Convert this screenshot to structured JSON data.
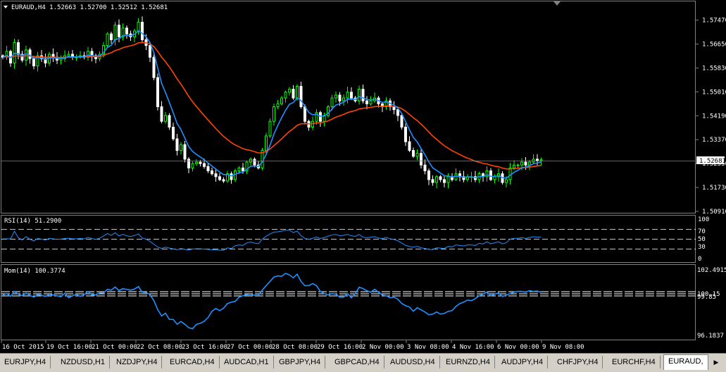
{
  "main_panel": {
    "header": "EURAUD,H4  1.52663 1.52700 1.52512 1.52681",
    "price_ticks": [
      "1.57470",
      "1.56650",
      "1.55830",
      "1.55010",
      "1.54190",
      "1.53370",
      "1.52550",
      "1.51730",
      "1.50910"
    ],
    "current_price": "1.52681"
  },
  "rsi_panel": {
    "header": "RSI(14) 51.2900",
    "ticks": [
      "100",
      "70",
      "50",
      "30",
      "0"
    ]
  },
  "mom_panel": {
    "header": "Mom(14) 100.3774",
    "ticks": [
      "102.4915",
      "100.15",
      "99.85",
      "96.1837"
    ]
  },
  "time_labels": [
    "16 Oct 2015",
    "19 Oct 16:00",
    "21 Oct 00:00",
    "22 Oct 08:00",
    "23 Oct 16:00",
    "27 Oct 00:00",
    "28 Oct 08:00",
    "29 Oct 16:00",
    "2 Nov 00:00",
    "3 Nov 08:00",
    "4 Nov 16:00",
    "6 Nov 00:00",
    "9 Nov 08:00"
  ],
  "tabs": [
    "EURJPY,H4",
    "NZDUSD,H1",
    "NZDJPY,H4",
    "EURCAD,H4",
    "AUDCAD,H1",
    "GBPJPY,H4",
    "GBPCAD,H4",
    "AUDUSD,H4",
    "EURNZD,H4",
    "AUDJPY,H4",
    "CHFJPY,H4",
    "EURCHF,H4",
    "EURAUD,"
  ],
  "active_tab": "EURAUD,",
  "colors": {
    "bull": "#00ff00",
    "bear": "#ffffff",
    "ma_fast": "#1e90ff",
    "ma_slow": "#ff4500",
    "indicator": "#1e90ff",
    "level": "#ffffff"
  },
  "chart_data": [
    {
      "type": "candlestick",
      "title": "EURAUD,H4",
      "ylim": [
        1.5091,
        1.5809
      ],
      "ohlc_header": {
        "open": 1.52663,
        "high": 1.527,
        "low": 1.52512,
        "close": 1.52681
      },
      "close": [
        1.562,
        1.564,
        1.56,
        1.567,
        1.563,
        1.561,
        1.5645,
        1.5615,
        1.559,
        1.5625,
        1.5615,
        1.56,
        1.563,
        1.562,
        1.561,
        1.5615,
        1.5625,
        1.563,
        1.562,
        1.562,
        1.5625,
        1.562,
        1.564,
        1.5625,
        1.5615,
        1.563,
        1.566,
        1.57,
        1.568,
        1.573,
        1.569,
        1.572,
        1.57,
        1.569,
        1.571,
        1.574,
        1.568,
        1.566,
        1.562,
        1.555,
        1.545,
        1.54,
        1.542,
        1.538,
        1.534,
        1.53,
        1.532,
        1.527,
        1.524,
        1.5255,
        1.526,
        1.5255,
        1.5245,
        1.523,
        1.522,
        1.521,
        1.52,
        1.5195,
        1.522,
        1.52,
        1.523,
        1.524,
        1.523,
        1.526,
        1.527,
        1.525,
        1.524,
        1.53,
        1.535,
        1.54,
        1.545,
        1.546,
        1.548,
        1.55,
        1.551,
        1.548,
        1.552,
        1.545,
        1.54,
        1.538,
        1.54,
        1.543,
        1.54,
        1.542,
        1.545,
        1.548,
        1.549,
        1.547,
        1.548,
        1.55,
        1.548,
        1.547,
        1.551,
        1.547,
        1.546,
        1.547,
        1.548,
        1.546,
        1.545,
        1.547,
        1.545,
        1.544,
        1.542,
        1.538,
        1.533,
        1.53,
        1.528,
        1.529,
        1.525,
        1.523,
        1.52,
        1.519,
        1.521,
        1.52,
        1.519,
        1.521,
        1.52,
        1.522,
        1.521,
        1.52,
        1.521,
        1.521,
        1.52,
        1.522,
        1.521,
        1.523,
        1.52,
        1.521,
        1.522,
        1.519,
        1.52,
        1.524,
        1.525,
        1.525,
        1.526,
        1.525,
        1.526,
        1.527,
        1.5265,
        1.5268
      ]
    },
    {
      "type": "line",
      "name": "RSI(14)",
      "ylim": [
        0,
        100
      ],
      "levels": [
        70,
        50,
        30
      ],
      "last": 51.29
    },
    {
      "type": "line",
      "name": "Mom(14)",
      "ylim": [
        96.1837,
        102.4915
      ],
      "levels": [
        100.15,
        99.85
      ],
      "last": 100.3774
    }
  ]
}
